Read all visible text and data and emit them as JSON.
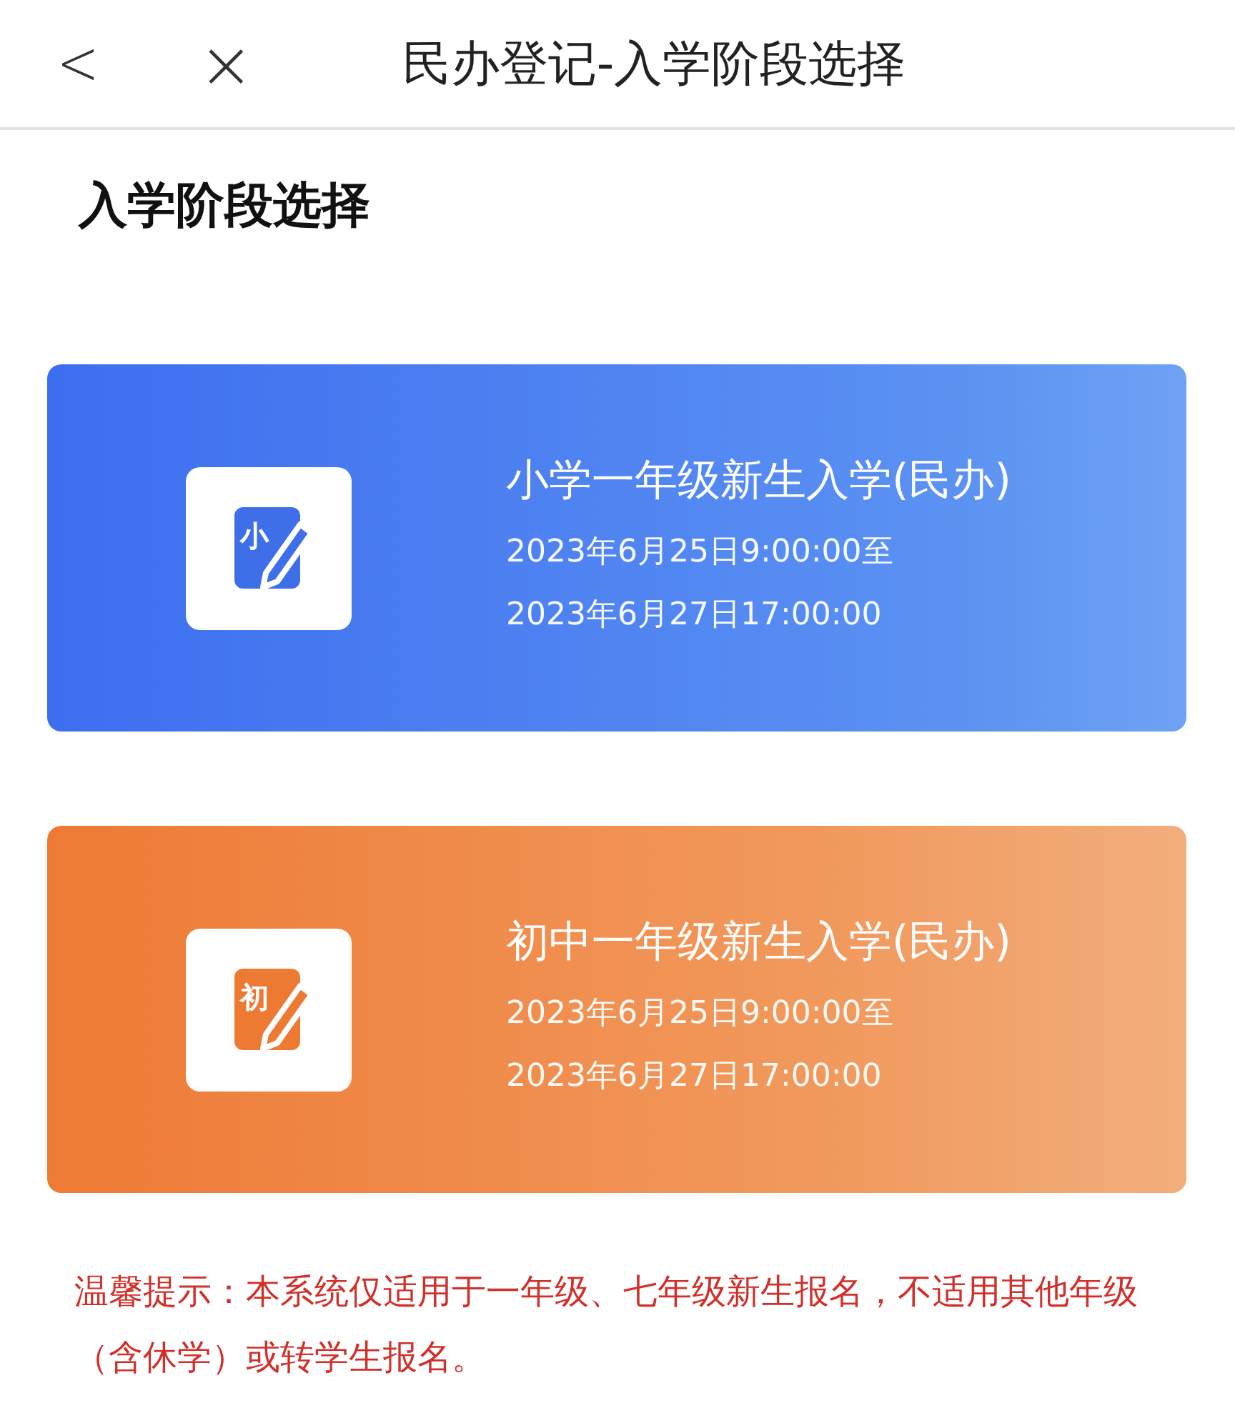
{
  "header": {
    "back": "<",
    "close": "×",
    "title": "民办登记-入学阶段选择"
  },
  "section_title": "入学阶段选择",
  "stages": [
    {
      "kind": "primary",
      "badge": "小",
      "title": "小学一年级新生入学(民办)",
      "start": "2023年6月25日9:00:00至",
      "end": "2023年6月27日17:00:00"
    },
    {
      "kind": "junior",
      "badge": "初",
      "title": "初中一年级新生入学(民办)",
      "start": "2023年6月25日9:00:00至",
      "end": "2023年6月27日17:00:00"
    }
  ],
  "notice": "温馨提示：本系统仅适用于一年级、七年级新生报名，不适用其他年级（含休学）或转学生报名。"
}
